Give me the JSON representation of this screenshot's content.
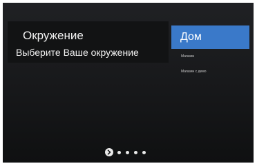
{
  "header": {
    "title": "Окружение",
    "subtitle": "Выберите Ваше окружение"
  },
  "options": [
    {
      "label": "Дом",
      "selected": true
    },
    {
      "label": "Магазин",
      "selected": false
    },
    {
      "label": "Магазин с демо",
      "selected": false
    }
  ],
  "pager": {
    "pages": 5,
    "current": 1,
    "current_icon": "chevron-right-icon"
  },
  "colors": {
    "accent": "#3a79c9",
    "background": "#1a1b1d"
  }
}
